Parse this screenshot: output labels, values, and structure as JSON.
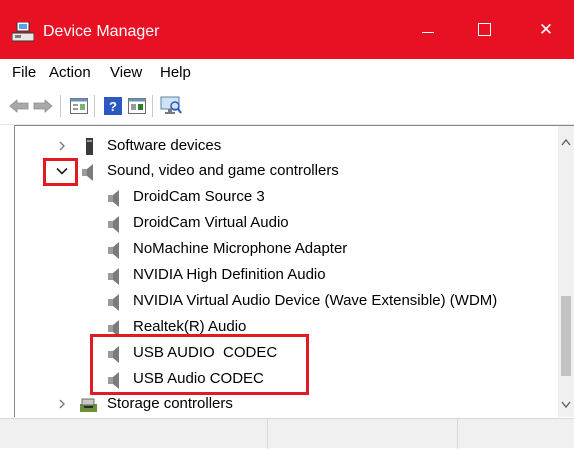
{
  "window": {
    "title": "Device Manager",
    "accent_color": "#e81123",
    "icons": {
      "app": "device-manager-icon",
      "minimize": "minimize-icon",
      "maximize": "maximize-icon",
      "close": "close-icon"
    },
    "close_glyph": "✕"
  },
  "menu": {
    "items": [
      "File",
      "Action",
      "View",
      "Help"
    ]
  },
  "toolbar": {
    "buttons": [
      "back-arrow-icon",
      "forward-arrow-icon",
      "properties-icon",
      "help-icon",
      "device-view-icon",
      "scan-hardware-icon"
    ]
  },
  "tree": {
    "rows": [
      {
        "label": "Software devices",
        "expander": "collapsed",
        "icon": "software-device-icon"
      },
      {
        "label": "Sound, video and game controllers",
        "expander": "expanded",
        "icon": "speaker-icon"
      },
      {
        "label": "DroidCam Source 3",
        "icon": "speaker-icon"
      },
      {
        "label": "DroidCam Virtual Audio",
        "icon": "speaker-icon"
      },
      {
        "label": "NoMachine Microphone Adapter",
        "icon": "speaker-icon"
      },
      {
        "label": "NVIDIA High Definition Audio",
        "icon": "speaker-icon"
      },
      {
        "label": "NVIDIA Virtual Audio Device (Wave Extensible) (WDM)",
        "icon": "speaker-icon"
      },
      {
        "label": "Realtek(R) Audio",
        "icon": "speaker-icon"
      },
      {
        "label": "USB AUDIO  CODEC",
        "icon": "speaker-icon"
      },
      {
        "label": "USB Audio CODEC",
        "icon": "speaker-icon"
      },
      {
        "label": "Storage controllers",
        "expander": "collapsed",
        "icon": "storage-controller-icon"
      }
    ]
  },
  "annotation_color": "#e21b23"
}
